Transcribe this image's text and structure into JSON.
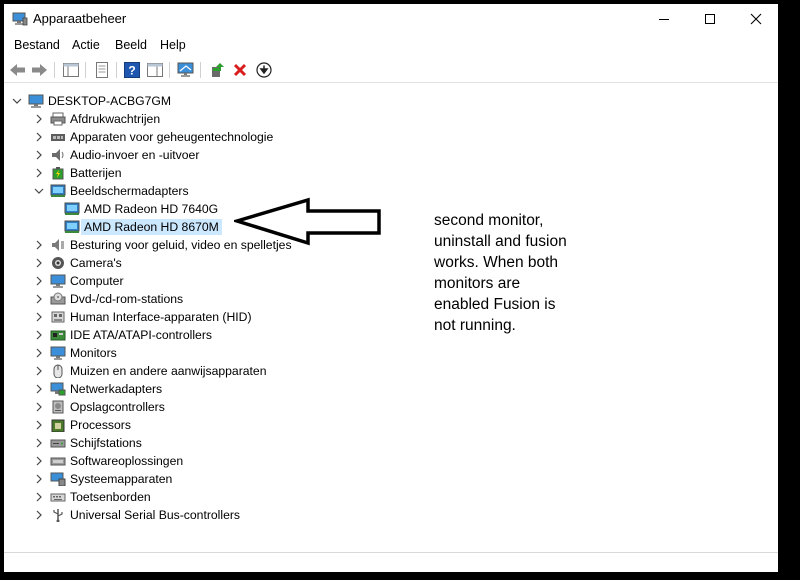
{
  "window": {
    "title": "Apparaatbeheer",
    "controls": [
      "minimize",
      "maximize",
      "close"
    ]
  },
  "menu": [
    "Bestand",
    "Actie",
    "Beeld",
    "Help"
  ],
  "toolbar": [
    "back-icon",
    "forward-icon",
    "show-hide-console-tree-icon",
    "properties-icon",
    "help-icon",
    "details-pane-icon",
    "scan-hardware-icon",
    "update-driver-icon",
    "uninstall-icon",
    "disable-device-icon"
  ],
  "tree": {
    "root": "DESKTOP-ACBG7GM",
    "items": [
      {
        "label": "Afdrukwachtrijen",
        "icon": "printer-icon"
      },
      {
        "label": "Apparaten voor geheugentechnologie",
        "icon": "memory-device-icon"
      },
      {
        "label": "Audio-invoer en -uitvoer",
        "icon": "speaker-icon"
      },
      {
        "label": "Batterijen",
        "icon": "battery-icon"
      },
      {
        "label": "Beeldschermadapters",
        "icon": "display-adapter-icon",
        "expanded": true,
        "children": [
          {
            "label": "AMD Radeon HD 7640G",
            "icon": "display-adapter-icon"
          },
          {
            "label": "AMD Radeon HD 8670M",
            "icon": "display-adapter-icon",
            "selected": true
          }
        ]
      },
      {
        "label": "Besturing voor geluid, video en spelletjes",
        "icon": "sound-controller-icon"
      },
      {
        "label": "Camera's",
        "icon": "camera-icon"
      },
      {
        "label": "Computer",
        "icon": "computer-icon"
      },
      {
        "label": "Dvd-/cd-rom-stations",
        "icon": "dvd-drive-icon"
      },
      {
        "label": "Human Interface-apparaten (HID)",
        "icon": "hid-icon"
      },
      {
        "label": "IDE ATA/ATAPI-controllers",
        "icon": "ide-controller-icon"
      },
      {
        "label": "Monitors",
        "icon": "monitor-icon"
      },
      {
        "label": "Muizen en andere aanwijsapparaten",
        "icon": "mouse-icon"
      },
      {
        "label": "Netwerkadapters",
        "icon": "network-adapter-icon"
      },
      {
        "label": "Opslagcontrollers",
        "icon": "storage-controller-icon"
      },
      {
        "label": "Processors",
        "icon": "processor-icon"
      },
      {
        "label": "Schijfstations",
        "icon": "disk-drive-icon"
      },
      {
        "label": "Softwareoplossingen",
        "icon": "software-component-icon"
      },
      {
        "label": "Systeemapparaten",
        "icon": "system-device-icon"
      },
      {
        "label": "Toetsenborden",
        "icon": "keyboard-icon"
      },
      {
        "label": "Universal Serial Bus-controllers",
        "icon": "usb-controller-icon"
      }
    ]
  },
  "annotation": {
    "lines": [
      "second monitor,",
      "uninstall and fusion",
      "works. When both",
      "monitors are",
      "enabled Fusion is",
      "not running."
    ]
  },
  "colors": {
    "selection": "#cce8ff",
    "uninstall_red": "#d81e1e",
    "monitor_blue": "#2f7fc8",
    "help_blue": "#1e56b0"
  }
}
